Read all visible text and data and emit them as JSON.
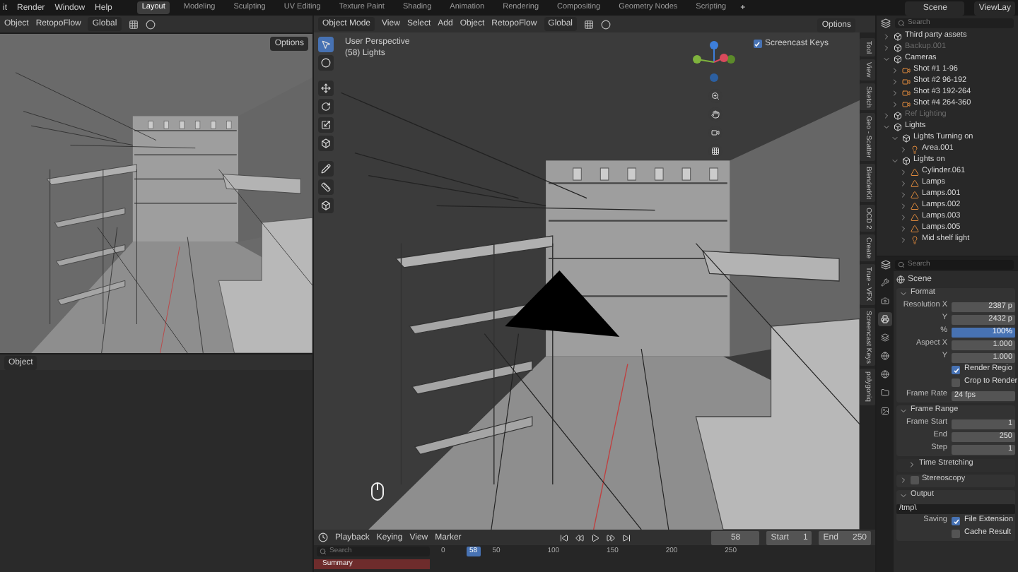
{
  "menu_bar": {
    "menus": [
      "it",
      "Render",
      "Window",
      "Help"
    ]
  },
  "workspace_tabs": [
    {
      "label": "Layout",
      "selected": true
    },
    {
      "label": "Modeling",
      "selected": false
    },
    {
      "label": "Sculpting",
      "selected": false
    },
    {
      "label": "UV Editing",
      "selected": false
    },
    {
      "label": "Texture Paint",
      "selected": false
    },
    {
      "label": "Shading",
      "selected": false
    },
    {
      "label": "Animation",
      "selected": false
    },
    {
      "label": "Rendering",
      "selected": false
    },
    {
      "label": "Compositing",
      "selected": false
    },
    {
      "label": "Geometry Nodes",
      "selected": false
    },
    {
      "label": "Scripting",
      "selected": false
    }
  ],
  "add_tab": "+",
  "scene": "Scene",
  "view_layer": "ViewLay",
  "left_viewport": {
    "menus": [
      "Object",
      "RetopoFlow"
    ],
    "orientation": "Global",
    "options": "Options"
  },
  "left_bottom": {
    "mode": "Object"
  },
  "main_viewport": {
    "menus": [
      "Object Mode",
      "View",
      "Select",
      "Add",
      "Object",
      "RetopoFlow"
    ],
    "orientation": "Global",
    "options": "Options",
    "overlay_text": [
      "User Perspective",
      "(58) Lights"
    ],
    "screencast_keys": {
      "label": "Screencast Keys",
      "checked": true
    },
    "side_tabs": [
      "Tool",
      "View",
      "Sketch",
      "Geo - Scatter",
      "BlenderKit",
      "OCD 2",
      "Create",
      "True - VFX",
      "Screencast Keys",
      "polygoniq"
    ]
  },
  "outliner": {
    "search_placeholder": "Search",
    "tree": [
      {
        "name": "Third party assets",
        "kind": "collection",
        "expanded": false,
        "disabled": false
      },
      {
        "name": "Backup.001",
        "kind": "collection",
        "expanded": false,
        "disabled": true
      },
      {
        "name": "Cameras",
        "kind": "collection",
        "expanded": true,
        "disabled": false,
        "children": [
          {
            "name": "Shot #1 1-96",
            "kind": "camera",
            "expanded": false,
            "disabled": false
          },
          {
            "name": "Shot #2 96-192",
            "kind": "camera",
            "expanded": false,
            "disabled": false
          },
          {
            "name": "Shot #3 192-264",
            "kind": "camera",
            "expanded": false,
            "disabled": false
          },
          {
            "name": "Shot #4 264-360",
            "kind": "camera",
            "expanded": false,
            "disabled": false
          }
        ]
      },
      {
        "name": "Ref Lighting",
        "kind": "collection",
        "expanded": false,
        "disabled": true
      },
      {
        "name": "Lights",
        "kind": "collection",
        "expanded": true,
        "disabled": false,
        "children": [
          {
            "name": "Lights Turning on",
            "kind": "collection",
            "expanded": true,
            "disabled": false,
            "children": [
              {
                "name": "Area.001",
                "kind": "light",
                "expanded": false,
                "disabled": false
              }
            ]
          },
          {
            "name": "Lights on",
            "kind": "collection",
            "expanded": true,
            "disabled": false,
            "children": [
              {
                "name": "Cylinder.061",
                "kind": "object",
                "expanded": false,
                "disabled": false
              },
              {
                "name": "Lamps",
                "kind": "object",
                "expanded": false,
                "disabled": false
              },
              {
                "name": "Lamps.001",
                "kind": "object",
                "expanded": false,
                "disabled": false
              },
              {
                "name": "Lamps.002",
                "kind": "object",
                "expanded": false,
                "disabled": false
              },
              {
                "name": "Lamps.003",
                "kind": "object",
                "expanded": false,
                "disabled": false
              },
              {
                "name": "Lamps.005",
                "kind": "object",
                "expanded": false,
                "disabled": false
              },
              {
                "name": "Mid shelf light",
                "kind": "light",
                "expanded": false,
                "disabled": false
              }
            ]
          }
        ]
      }
    ]
  },
  "properties": {
    "search_placeholder": "Search",
    "breadcrumb": "Scene",
    "tabs": [
      {
        "kind": "tool",
        "selected": false
      },
      {
        "kind": "render",
        "selected": false
      },
      {
        "kind": "output",
        "selected": true
      },
      {
        "kind": "view_layer",
        "selected": false
      },
      {
        "kind": "scene",
        "selected": false
      },
      {
        "kind": "world",
        "selected": false
      },
      {
        "kind": "collection",
        "selected": false
      },
      {
        "kind": "texture",
        "selected": false
      }
    ],
    "panels": [
      {
        "kind": "panel",
        "title": "Format",
        "expanded": true,
        "rows": [
          {
            "kind": "field",
            "label": "Resolution X",
            "value": "2387 p"
          },
          {
            "kind": "field",
            "label": "Y",
            "value": "2432 p"
          },
          {
            "kind": "slider",
            "label": "%",
            "value": "100%",
            "level": 1
          },
          {
            "kind": "field",
            "label": "Aspect X",
            "value": "1.000"
          },
          {
            "kind": "field",
            "label": "Y",
            "value": "1.000"
          },
          {
            "kind": "checkbox",
            "label": "Render Regio",
            "checked": true
          },
          {
            "kind": "checkbox",
            "label": "Crop to Render",
            "checked": false
          },
          {
            "kind": "dropdown",
            "label": "Frame Rate",
            "value": "24 fps"
          }
        ]
      },
      {
        "kind": "panel",
        "title": "Frame Range",
        "expanded": true,
        "rows": [
          {
            "kind": "field",
            "label": "Frame Start",
            "value": "1"
          },
          {
            "kind": "field",
            "label": "End",
            "value": "250"
          },
          {
            "kind": "field",
            "label": "Step",
            "value": "1"
          }
        ]
      },
      {
        "kind": "subpanel",
        "title": "Time Stretching",
        "expanded": false
      },
      {
        "kind": "panel",
        "title": "Stereoscopy",
        "expanded": false,
        "enabled": false
      },
      {
        "kind": "panel",
        "title": "Output",
        "expanded": true,
        "rows": [
          {
            "kind": "path",
            "value": "/tmp\\"
          },
          {
            "kind": "checkbox",
            "label": "File Extension",
            "checked": true,
            "prefix": "Saving"
          },
          {
            "kind": "checkbox",
            "label": "Cache Result",
            "checked": false
          }
        ]
      }
    ]
  },
  "timeline": {
    "menus": [
      "Playback",
      "Keying",
      "View",
      "Marker"
    ],
    "current_frame": "58",
    "start_label": "Start",
    "start": "1",
    "end_label": "End",
    "end": "250",
    "search_placeholder": "Search",
    "ruler": [
      "0",
      "50",
      "100",
      "150",
      "200",
      "250"
    ],
    "ruler_current": "58",
    "channel": "Summary"
  }
}
